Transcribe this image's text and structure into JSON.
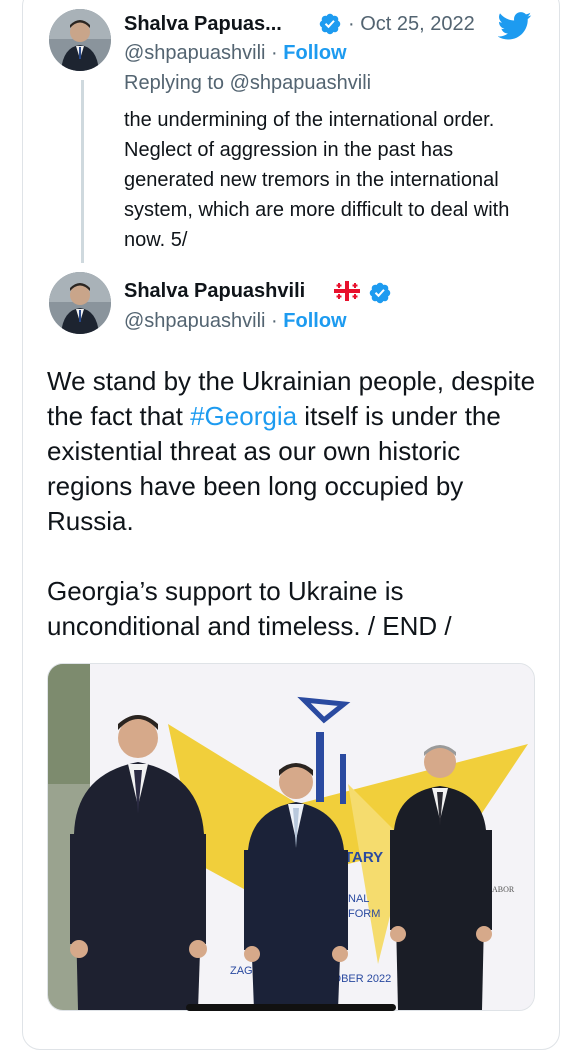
{
  "tweet_reply": {
    "name": "Shalva Papuas...",
    "date": "· Oct 25, 2022",
    "handle": "@shpapuashvili",
    "separator": " · ",
    "follow": "Follow",
    "replying_to": "Replying to @shpapuashvili",
    "text": "the undermining of the international order. Neglect of aggression in the past has generated new tremors in the international system, which are more difficult to deal with now. 5/"
  },
  "tweet_main": {
    "name": "Shalva Papuashvili",
    "handle": "@shpapuashvili",
    "separator": " · ",
    "follow": "Follow",
    "text_part1": "We stand by the Ukrainian people, despite the fact that ",
    "hashtag": "#Georgia",
    "text_part2": " itself is under the existential threat as our own historic regions have been long occupied by Russia.",
    "text_para2": "Georgia’s support to Ukraine is unconditional and timeless. / END /"
  },
  "photo": {
    "banner_text_1": "TARY",
    "banner_text_2": "NAL",
    "banner_text_3": "FORM",
    "banner_text_4": "ZAGREB",
    "banner_text_5": "2",
    "banner_text_6": "TOBER 2022",
    "banner_text_7": "ABOR"
  },
  "colors": {
    "accent": "#1d9bf0",
    "secondary_text": "#536471",
    "primary_text": "#0f1419",
    "banner_yellow": "#f1cf3b"
  },
  "icons": {
    "verified": "verified-badge-icon",
    "brand": "twitter-bird-icon",
    "flag": "georgia-flag-icon"
  }
}
